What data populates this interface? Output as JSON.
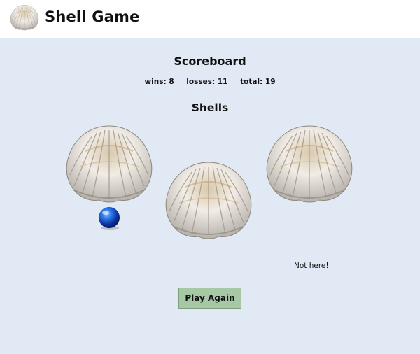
{
  "header": {
    "title": "Shell Game",
    "logo_icon": "seashell-icon"
  },
  "scoreboard": {
    "title": "Scoreboard",
    "wins_label": "wins:",
    "wins": "8",
    "losses_label": "losses:",
    "losses": "11",
    "total_label": "total:",
    "total": "19"
  },
  "shells": {
    "title": "Shells",
    "items": [
      {
        "icon": "seashell-icon",
        "lifted": true,
        "has_ball": true
      },
      {
        "icon": "seashell-icon",
        "lifted": false,
        "has_ball": false
      },
      {
        "icon": "seashell-icon",
        "lifted": true,
        "has_ball": false
      }
    ],
    "ball_icon": "blue-ball-icon"
  },
  "feedback": "Not here!",
  "play_again_label": "Play Again",
  "colors": {
    "header_bg": "#ffffff",
    "main_bg": "#e1e9f5",
    "button_bg": "#a7c8a5",
    "ball": "#1a4fd6"
  }
}
